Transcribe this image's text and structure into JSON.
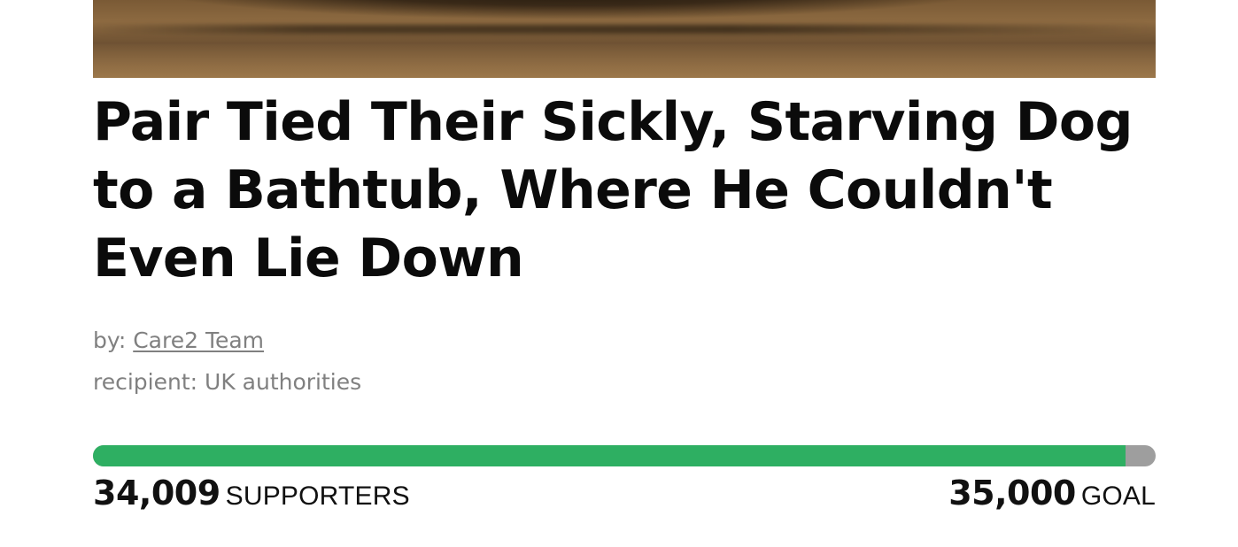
{
  "hero_image": {
    "description": "cropped photo bottom edge (wooden floor)"
  },
  "petition": {
    "title": "Pair Tied Their Sickly, Starving Dog to a Bathtub, Where He Couldn't Even Lie Down",
    "by_prefix": "by: ",
    "author": "Care2 Team",
    "recipient_prefix": "recipient: ",
    "recipient": "UK authorities"
  },
  "progress": {
    "supporters_count": "34,009",
    "supporters_label": "SUPPORTERS",
    "goal_count": "35,000",
    "goal_label": "GOAL",
    "fraction": 0.9717,
    "fill_color": "#2eaf62",
    "track_color": "#9e9e9e"
  }
}
